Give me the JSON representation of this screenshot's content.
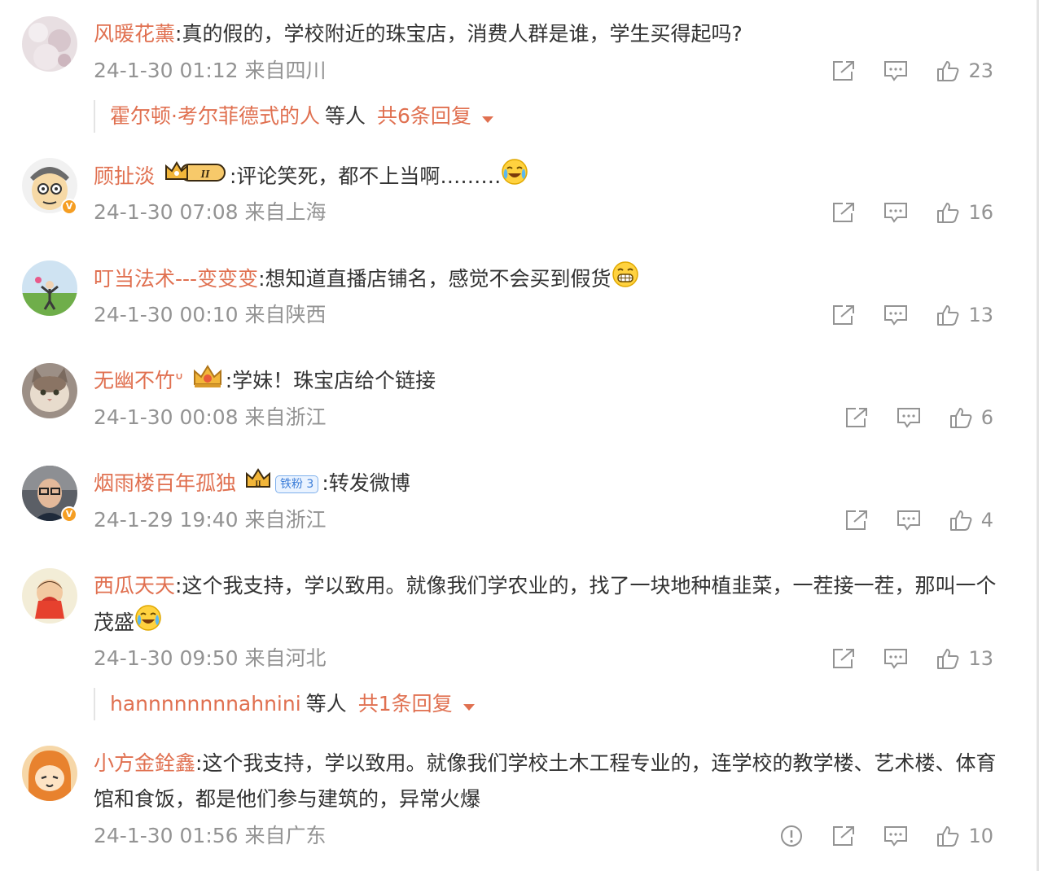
{
  "colors": {
    "username": "#e07050",
    "meta_text": "#939393",
    "body_text": "#333333",
    "verified_badge": "#f59e23"
  },
  "comments": [
    {
      "user": "风暖花薰",
      "text": ":真的假的，学校附近的珠宝店，消费人群是谁，学生买得起吗?",
      "time": "24-1-30 01:12",
      "location": "来自四川",
      "likes": "23",
      "reply": {
        "name": "霍尔顿·考尔菲德式的人",
        "etc": "等人",
        "total": "共6条回复"
      }
    },
    {
      "user": "顾扯淡",
      "badge_icon": "vip-crown-II-badge",
      "text": ":评论笑死，都不上当啊………",
      "emoji": "laugh-cry-emoji",
      "time": "24-1-30 07:08",
      "location": "来自上海",
      "likes": "16",
      "verified": "V"
    },
    {
      "user": "叮当法术---变变变",
      "text": ":想知道直播店铺名，感觉不会买到假货",
      "emoji": "grin-emoji",
      "time": "24-1-30 00:10",
      "location": "来自陕西",
      "likes": "13"
    },
    {
      "user": "无幽不竹ᐡ",
      "badge_icon": "vip-crown-badge",
      "text": ":学妹！珠宝店给个链接",
      "time": "24-1-30 00:08",
      "location": "来自浙江",
      "likes": "6"
    },
    {
      "user": "烟雨楼百年孤独",
      "badge_icon": "crown-badge",
      "fan_badge": "铁粉 3",
      "text": ":转发微博",
      "time": "24-1-29 19:40",
      "location": "来自浙江",
      "likes": "4",
      "verified": "V"
    },
    {
      "user": "西瓜天天",
      "text": ":这个我支持，学以致用。就像我们学农业的，找了一块地种植韭菜，一茬接一茬，那叫一个茂盛",
      "emoji": "laugh-cry-emoji",
      "time": "24-1-30 09:50",
      "location": "来自河北",
      "likes": "13",
      "reply": {
        "name": "hannnnnnnnahnini",
        "etc": "等人",
        "total": "共1条回复"
      }
    },
    {
      "user": "小方金銓鑫",
      "text": ":这个我支持，学以致用。就像我们学校土木工程专业的，连学校的教学楼、艺术楼、体育馆和食饭，都是他们参与建筑的，异常火爆",
      "time": "24-1-30 01:56",
      "location": "来自广东",
      "likes": "10",
      "report_icon": "alert-circle-icon"
    }
  ]
}
